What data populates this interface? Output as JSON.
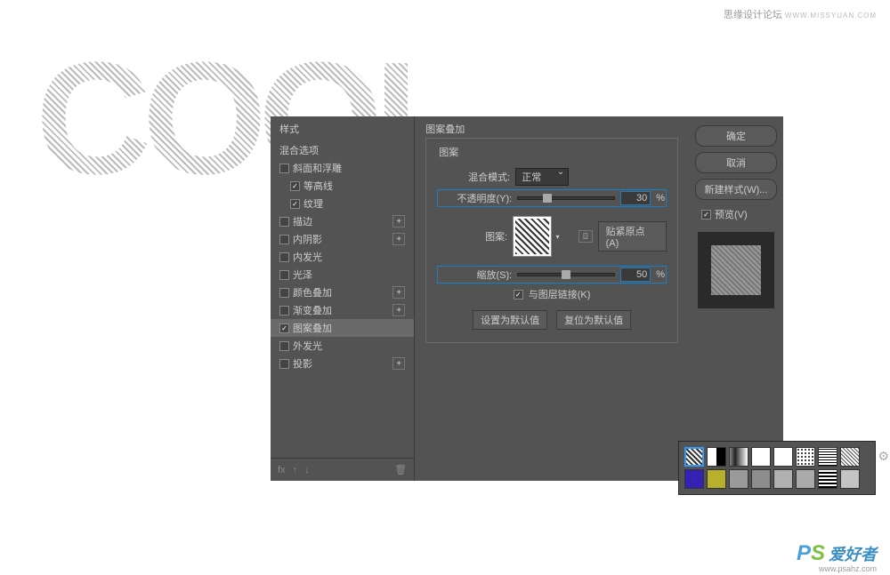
{
  "watermark": {
    "text": "思缘设计论坛",
    "url": "WWW.MISSYUAN.COM"
  },
  "bgText": "COOL",
  "logo": {
    "p": "P",
    "s": "S",
    "zh": "爱好者",
    "url": "www.psahz.com"
  },
  "dialog": {
    "stylesHeader": "样式",
    "blendOptions": "混合选项",
    "items": [
      {
        "label": "斜面和浮雕",
        "checked": false,
        "hasPlus": false
      },
      {
        "label": "等高线",
        "checked": true,
        "hasPlus": false,
        "indent": true
      },
      {
        "label": "纹理",
        "checked": true,
        "hasPlus": false,
        "indent": true
      },
      {
        "label": "描边",
        "checked": false,
        "hasPlus": true
      },
      {
        "label": "内阴影",
        "checked": false,
        "hasPlus": true
      },
      {
        "label": "内发光",
        "checked": false,
        "hasPlus": false
      },
      {
        "label": "光泽",
        "checked": false,
        "hasPlus": false
      },
      {
        "label": "颜色叠加",
        "checked": false,
        "hasPlus": true
      },
      {
        "label": "渐变叠加",
        "checked": false,
        "hasPlus": true
      },
      {
        "label": "图案叠加",
        "checked": true,
        "hasPlus": false,
        "selected": true
      },
      {
        "label": "外发光",
        "checked": false,
        "hasPlus": false
      },
      {
        "label": "投影",
        "checked": false,
        "hasPlus": true
      }
    ],
    "footer": {
      "fx": "fx"
    }
  },
  "mid": {
    "title": "图案叠加",
    "fieldset": "图案",
    "blendModeLabel": "混合模式:",
    "blendModeValue": "正常",
    "opacityLabel": "不透明度(Y):",
    "opacityValue": "30",
    "percent": "%",
    "patternLabel": "图案:",
    "snapLabel": "贴紧原点 (A)",
    "scaleLabel": "缩放(S):",
    "scaleValue": "50",
    "linkLabel": "与图层链接(K)",
    "setDefault": "设置为默认值",
    "resetDefault": "复位为默认值"
  },
  "right": {
    "ok": "确定",
    "cancel": "取消",
    "newStyle": "新建样式(W)...",
    "preview": "预览(V)"
  },
  "patterns": {
    "count": 16
  }
}
